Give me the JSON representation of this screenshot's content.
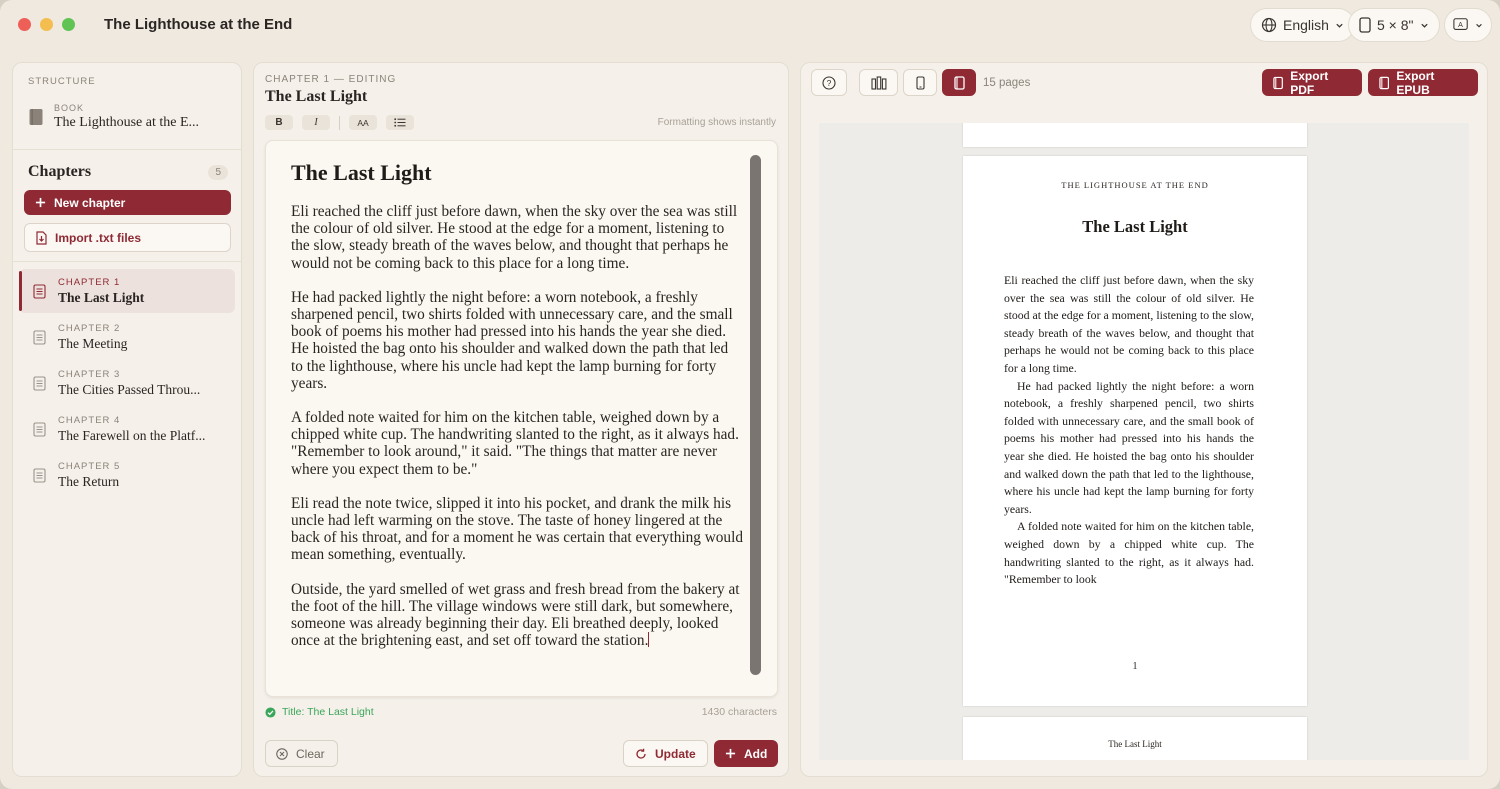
{
  "app": {
    "title": "The Lighthouse at the End"
  },
  "toolbar": {
    "language": "English",
    "page_size": "5 × 8\""
  },
  "sidebar": {
    "structure_label": "STRUCTURE",
    "book_label": "BOOK",
    "book_title": "The Lighthouse at the E...",
    "chapters_title": "Chapters",
    "chapters_count": "5",
    "new_chapter": "New chapter",
    "import": "Import .txt files",
    "chapters": [
      {
        "number": "CHAPTER 1",
        "title": "The Last Light",
        "active": true
      },
      {
        "number": "CHAPTER 2",
        "title": "The Meeting"
      },
      {
        "number": "CHAPTER 3",
        "title": "The Cities Passed Throu..."
      },
      {
        "number": "CHAPTER 4",
        "title": "The Farewell on the Platf..."
      },
      {
        "number": "CHAPTER 5",
        "title": "The Return"
      }
    ]
  },
  "editor": {
    "eyebrow": "CHAPTER 1 — EDITING",
    "title": "The Last Light",
    "format": {
      "bold": "B",
      "italic": "I",
      "size": "AA"
    },
    "hint": "Formatting shows instantly",
    "doc_title": "The Last Light",
    "paragraphs": [
      "Eli reached the cliff just before dawn, when the sky over the sea was still the colour of old silver. He stood at the edge for a moment, listening to the slow, steady breath of the waves below, and thought that perhaps he would not be coming back to this place for a long time.",
      "He had packed lightly the night before: a worn notebook, a freshly sharpened pencil, two shirts folded with unnecessary care, and the small book of poems his mother had pressed into his hands the year she died. He hoisted the bag onto his shoulder and walked down the path that led to the lighthouse, where his uncle had kept the lamp burning for forty years.",
      "A folded note waited for him on the kitchen table, weighed down by a chipped white cup. The handwriting slanted to the right, as it always had. \"Remember to look around,\" it said. \"The things that matter are never where you expect them to be.\"",
      "Eli read the note twice, slipped it into his pocket, and drank the milk his uncle had left warming on the stove. The taste of honey lingered at the back of his throat, and for a moment he was certain that everything would mean something, eventually.",
      "Outside, the yard smelled of wet grass and fresh bread from the bakery at the foot of the hill. The village windows were still dark, but somewhere, someone was already beginning their day. Eli breathed deeply, looked once at the brightening east, and set off toward the station."
    ],
    "status": "Title: The Last Light",
    "char_count": "1430 characters",
    "clear": "Clear",
    "update": "Update",
    "add": "Add"
  },
  "preview": {
    "pages_label": "15 pages",
    "export_pdf": "Export PDF",
    "export_epub": "Export EPUB",
    "running_head": "THE LIGHTHOUSE AT THE END",
    "page_title": "The Last Light",
    "page_paragraphs": [
      "Eli reached the cliff just before dawn, when the sky over the sea was still the colour of old silver. He stood at the edge for a mo­ment, listening to the slow, steady breath of the waves below, and thought that perhaps he would not be coming back to this place for a long time.",
      "He had packed lightly the night before: a worn notebook, a freshly sharpened pencil, two shirts folded with unnecessary care, and the small book of poems his mother had pressed into his hands the year she died. He hoisted the bag onto his shoulder and walked down the path that led to the lighthouse, where his uncle had kept the lamp burning for forty years.",
      "A folded note waited for him on the kitchen table, weighed down by a chipped white cup. The handwriting slanted to the right, as it always had. \"Remember to look"
    ],
    "page_number": "1",
    "next_page_head": "The Last Light"
  },
  "colors": {
    "accent": "#8f2a34",
    "success": "#3aa65a",
    "background": "#efe9df"
  }
}
